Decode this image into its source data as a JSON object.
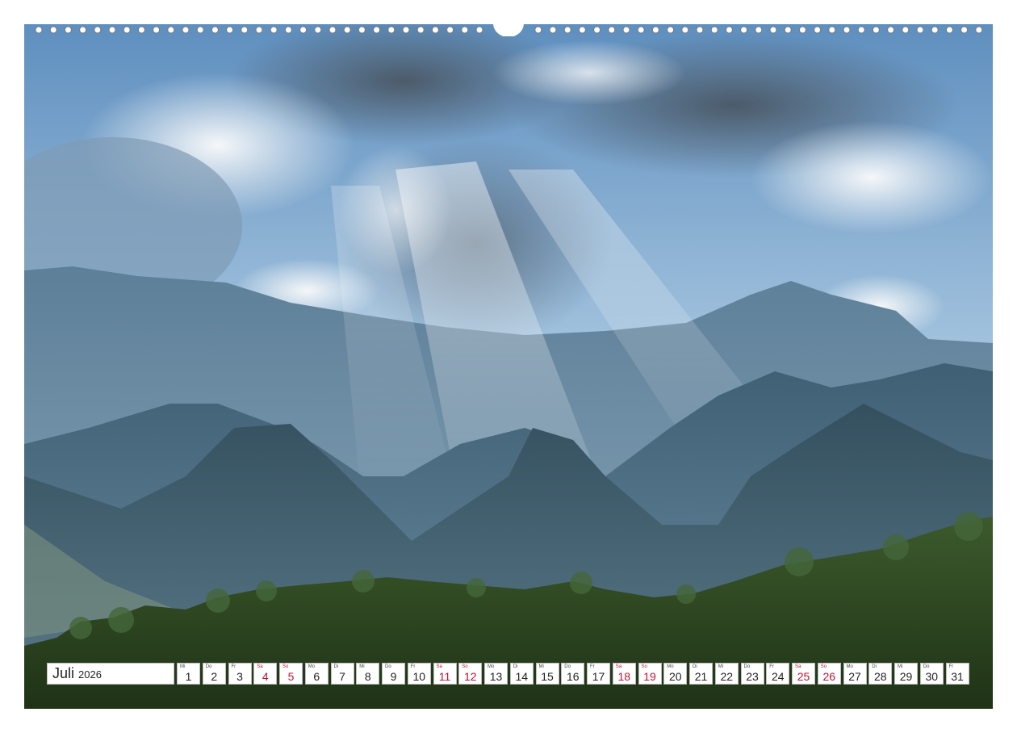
{
  "calendar": {
    "month": "Juli",
    "year": "2026",
    "weekend_color": "#c8102e",
    "days": [
      {
        "wd": "Mi",
        "n": "1",
        "weekend": false
      },
      {
        "wd": "Do",
        "n": "2",
        "weekend": false
      },
      {
        "wd": "Fr",
        "n": "3",
        "weekend": false
      },
      {
        "wd": "Sa",
        "n": "4",
        "weekend": true
      },
      {
        "wd": "So",
        "n": "5",
        "weekend": true
      },
      {
        "wd": "Mo",
        "n": "6",
        "weekend": false
      },
      {
        "wd": "Di",
        "n": "7",
        "weekend": false
      },
      {
        "wd": "Mi",
        "n": "8",
        "weekend": false
      },
      {
        "wd": "Do",
        "n": "9",
        "weekend": false
      },
      {
        "wd": "Fr",
        "n": "10",
        "weekend": false
      },
      {
        "wd": "Sa",
        "n": "11",
        "weekend": true
      },
      {
        "wd": "So",
        "n": "12",
        "weekend": true
      },
      {
        "wd": "Mo",
        "n": "13",
        "weekend": false
      },
      {
        "wd": "Di",
        "n": "14",
        "weekend": false
      },
      {
        "wd": "Mi",
        "n": "15",
        "weekend": false
      },
      {
        "wd": "Do",
        "n": "16",
        "weekend": false
      },
      {
        "wd": "Fr",
        "n": "17",
        "weekend": false
      },
      {
        "wd": "Sa",
        "n": "18",
        "weekend": true
      },
      {
        "wd": "So",
        "n": "19",
        "weekend": true
      },
      {
        "wd": "Mo",
        "n": "20",
        "weekend": false
      },
      {
        "wd": "Di",
        "n": "21",
        "weekend": false
      },
      {
        "wd": "Mi",
        "n": "22",
        "weekend": false
      },
      {
        "wd": "Do",
        "n": "23",
        "weekend": false
      },
      {
        "wd": "Fr",
        "n": "24",
        "weekend": false
      },
      {
        "wd": "Sa",
        "n": "25",
        "weekend": true
      },
      {
        "wd": "So",
        "n": "26",
        "weekend": true
      },
      {
        "wd": "Mo",
        "n": "27",
        "weekend": false
      },
      {
        "wd": "Di",
        "n": "28",
        "weekend": false
      },
      {
        "wd": "Mi",
        "n": "29",
        "weekend": false
      },
      {
        "wd": "Do",
        "n": "30",
        "weekend": false
      },
      {
        "wd": "Fr",
        "n": "31",
        "weekend": false
      }
    ]
  },
  "photo": {
    "subject": "mountain-landscape-icon",
    "sky_color": "#7fa7c9",
    "mountain_color": "#4f6f86",
    "forest_color": "#2f4a25"
  },
  "binding": {
    "ring_icon": "binding-hole-icon",
    "hanger_icon": "hanger-notch-icon"
  }
}
